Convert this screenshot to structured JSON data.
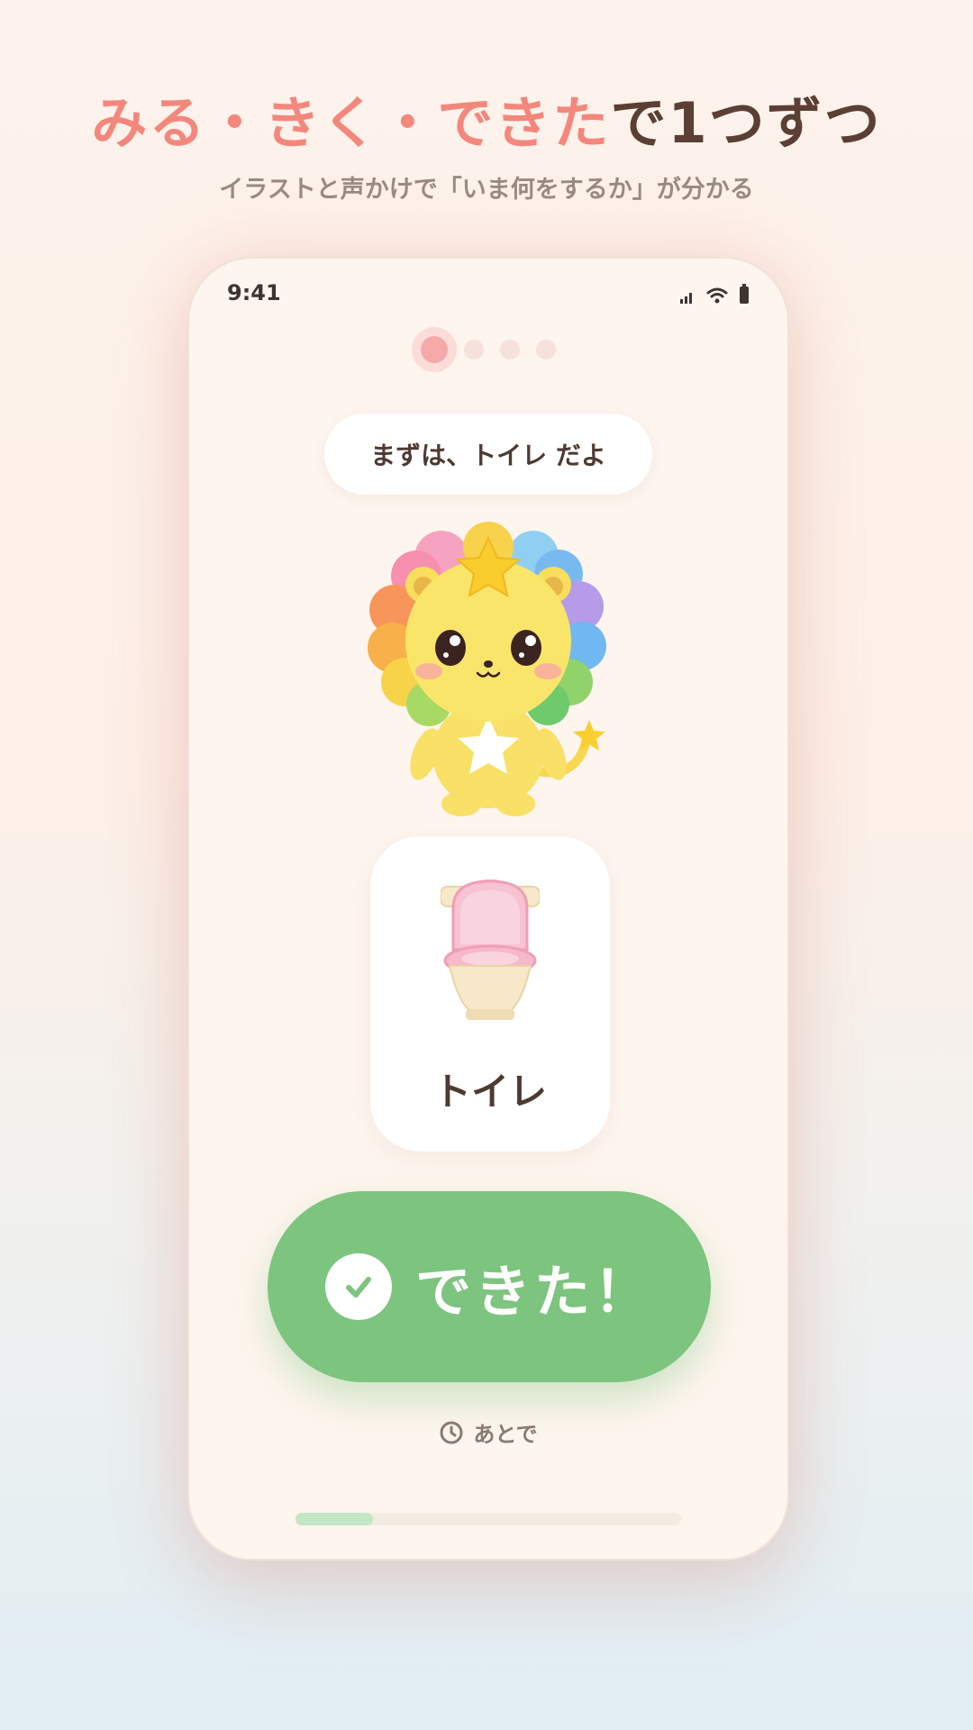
{
  "headline": {
    "accent": "みる・きく・できた",
    "rest": "で1つずつ"
  },
  "subheadline": "イラストと声かけで「いま何をするか」が分かる",
  "status_bar": {
    "time": "9:41",
    "icons": [
      "signal-icon",
      "wifi-icon",
      "battery-icon"
    ]
  },
  "steps": {
    "total": 4,
    "current": 1
  },
  "speech_bubble": "まずは、トイレ だよ",
  "mascot": {
    "icon": "rainbow-lion-mascot"
  },
  "task_card": {
    "icon": "toilet-icon",
    "label": "トイレ"
  },
  "done_button": {
    "label": "できた！",
    "icon": "check-icon",
    "color": "#7dc47f"
  },
  "later_button": {
    "label": "あとで",
    "icon": "clock-icon"
  },
  "progress": {
    "fraction": 0.2
  },
  "colors": {
    "accent": "#f4877c",
    "text": "#5b3f35",
    "success": "#7dc47f"
  }
}
